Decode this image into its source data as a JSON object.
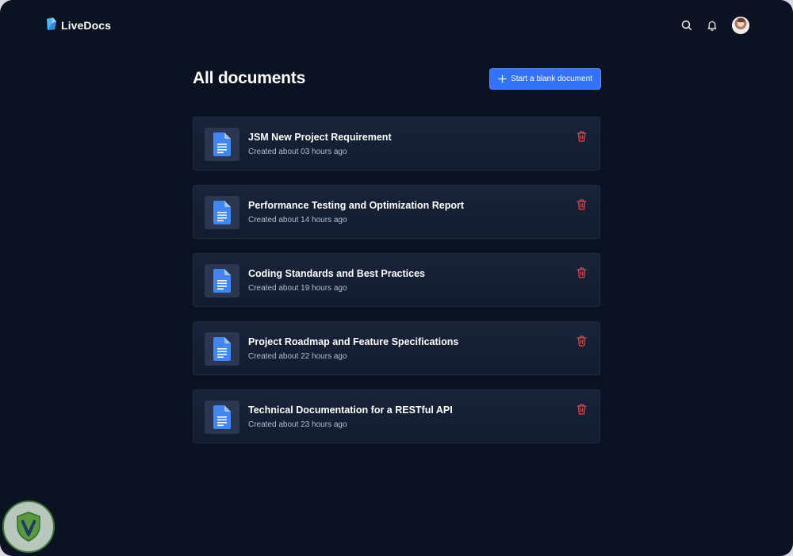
{
  "app": {
    "brand_name": "LiveDocs"
  },
  "header": {
    "icons": [
      "livedocs-logo-icon",
      "search-icon",
      "bell-icon"
    ],
    "avatar": "user-avatar"
  },
  "main": {
    "title": "All documents",
    "new_button": {
      "label": "Start a blank document",
      "icon": "plus-icon"
    },
    "documents": [
      {
        "title": "JSM New Project Requirement",
        "meta": "Created about 03 hours ago"
      },
      {
        "title": "Performance Testing and Optimization Report",
        "meta": "Created about 14 hours ago"
      },
      {
        "title": "Coding Standards and Best Practices",
        "meta": "Created about 19 hours ago"
      },
      {
        "title": "Project Roadmap and Feature Specifications",
        "meta": "Created about 22 hours ago"
      },
      {
        "title": "Technical Documentation for a RESTful API",
        "meta": "Created about 23 hours ago"
      }
    ]
  },
  "colors": {
    "background": "#0b1221",
    "card": "#161f33",
    "accent": "#3371ff",
    "doc_icon": "#4285f4",
    "delete": "#e5484d",
    "muted_text": "#b4bccc"
  }
}
